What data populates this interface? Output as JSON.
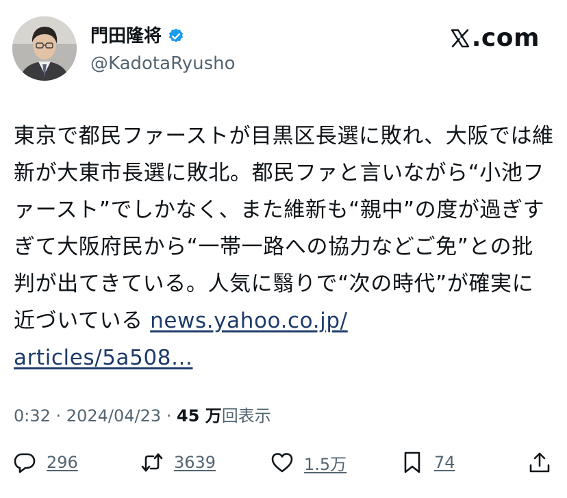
{
  "author": {
    "display_name": "門田隆将",
    "handle": "@KadotaRyusho",
    "verified": true
  },
  "brand": {
    "domain": ".com",
    "mark": "x-logo-icon"
  },
  "tweet": {
    "text": "東京で都民ファーストが目黒区長選に敗れ、大阪では維新が大東市長選に敗北。都民ファと言いながら“小池ファースト”でしかなく、また維新も“親中”の度が過ぎすぎて大阪府民から“一帯一路への協力などご免”との批判が出てきている。人気に翳りで“次の時代”が確実に近づいている ",
    "link_line1": "news.yahoo.co.jp/",
    "link_line2": "articles/5a508..."
  },
  "meta": {
    "time": "0:32",
    "sep1": " · ",
    "date": "2024/04/23",
    "sep2": " · ",
    "views_count": "45 万",
    "views_label": "回表示"
  },
  "actions": {
    "replies": "296",
    "reposts": "3639",
    "likes": "1.5万",
    "bookmarks": "74"
  },
  "colors": {
    "text": "#0f1419",
    "secondary": "#536471",
    "link": "#1d3b6b",
    "verified": "#1d9bf0"
  }
}
